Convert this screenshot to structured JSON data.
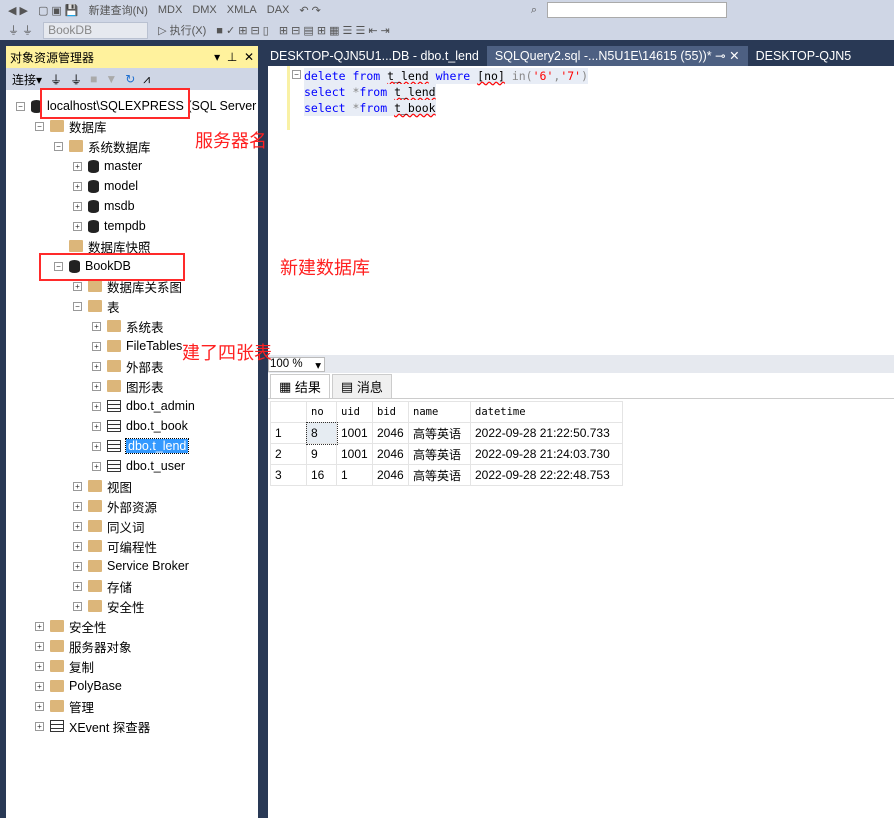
{
  "toolbar": {
    "new_query": "新建查询(N)",
    "database": "BookDB",
    "execute": "执行(X)",
    "mdx": "MDX",
    "dmx": "DMX",
    "xmla": "XMLA",
    "dax": "DAX"
  },
  "object_explorer": {
    "title": "对象资源管理器",
    "connect": "连接",
    "items": [
      {
        "label": "localhost\\SQLEXPRESS (SQL Server",
        "level": 0,
        "exp": "−",
        "icon": "server"
      },
      {
        "label": "数据库",
        "level": 1,
        "exp": "−",
        "icon": "folder"
      },
      {
        "label": "系统数据库",
        "level": 2,
        "exp": "−",
        "icon": "folder"
      },
      {
        "label": "master",
        "level": 3,
        "exp": "+",
        "icon": "db"
      },
      {
        "label": "model",
        "level": 3,
        "exp": "+",
        "icon": "db"
      },
      {
        "label": "msdb",
        "level": 3,
        "exp": "+",
        "icon": "db"
      },
      {
        "label": "tempdb",
        "level": 3,
        "exp": "+",
        "icon": "db"
      },
      {
        "label": "数据库快照",
        "level": 2,
        "exp": "",
        "icon": "folder"
      },
      {
        "label": "BookDB",
        "level": 2,
        "exp": "−",
        "icon": "db"
      },
      {
        "label": "数据库关系图",
        "level": 3,
        "exp": "+",
        "icon": "folder"
      },
      {
        "label": "表",
        "level": 3,
        "exp": "−",
        "icon": "folder"
      },
      {
        "label": "系统表",
        "level": 4,
        "exp": "+",
        "icon": "folder"
      },
      {
        "label": "FileTables",
        "level": 4,
        "exp": "+",
        "icon": "folder"
      },
      {
        "label": "外部表",
        "level": 4,
        "exp": "+",
        "icon": "folder"
      },
      {
        "label": "图形表",
        "level": 4,
        "exp": "+",
        "icon": "folder"
      },
      {
        "label": "dbo.t_admin",
        "level": 4,
        "exp": "+",
        "icon": "table"
      },
      {
        "label": "dbo.t_book",
        "level": 4,
        "exp": "+",
        "icon": "table"
      },
      {
        "label": "dbo.t_lend",
        "level": 4,
        "exp": "+",
        "icon": "table",
        "selected": true
      },
      {
        "label": "dbo.t_user",
        "level": 4,
        "exp": "+",
        "icon": "table"
      },
      {
        "label": "视图",
        "level": 3,
        "exp": "+",
        "icon": "folder"
      },
      {
        "label": "外部资源",
        "level": 3,
        "exp": "+",
        "icon": "folder"
      },
      {
        "label": "同义词",
        "level": 3,
        "exp": "+",
        "icon": "folder"
      },
      {
        "label": "可编程性",
        "level": 3,
        "exp": "+",
        "icon": "folder"
      },
      {
        "label": "Service Broker",
        "level": 3,
        "exp": "+",
        "icon": "folder"
      },
      {
        "label": "存储",
        "level": 3,
        "exp": "+",
        "icon": "folder"
      },
      {
        "label": "安全性",
        "level": 3,
        "exp": "+",
        "icon": "folder"
      },
      {
        "label": "安全性",
        "level": 1,
        "exp": "+",
        "icon": "folder"
      },
      {
        "label": "服务器对象",
        "level": 1,
        "exp": "+",
        "icon": "folder"
      },
      {
        "label": "复制",
        "level": 1,
        "exp": "+",
        "icon": "folder"
      },
      {
        "label": "PolyBase",
        "level": 1,
        "exp": "+",
        "icon": "folder"
      },
      {
        "label": "管理",
        "level": 1,
        "exp": "+",
        "icon": "folder"
      },
      {
        "label": "XEvent 探查器",
        "level": 1,
        "exp": "+",
        "icon": "xevent"
      }
    ]
  },
  "tabs": [
    {
      "label": "DESKTOP-QJN5U1...DB - dbo.t_lend"
    },
    {
      "label": "SQLQuery2.sql -...N5U1E\\14615 (55))*",
      "active": true
    },
    {
      "label": "DESKTOP-QJN5"
    }
  ],
  "editor": {
    "lines": [
      [
        {
          "t": "delete",
          "c": "kw"
        },
        {
          "t": " "
        },
        {
          "t": "from",
          "c": "kw"
        },
        {
          "t": " "
        },
        {
          "t": "t_lend",
          "c": "sq"
        },
        {
          "t": " "
        },
        {
          "t": "where",
          "c": "kw"
        },
        {
          "t": " "
        },
        {
          "t": "[no]",
          "c": "sq"
        },
        {
          "t": " "
        },
        {
          "t": "in(",
          "c": "gr"
        },
        {
          "t": "'6'",
          "c": "str"
        },
        {
          "t": ",",
          "c": "gr"
        },
        {
          "t": "'7'",
          "c": "str"
        },
        {
          "t": ")",
          "c": "gr"
        }
      ],
      [
        {
          "t": "select",
          "c": "kw"
        },
        {
          "t": " "
        },
        {
          "t": "*",
          "c": "gr"
        },
        {
          "t": "from",
          "c": "kw"
        },
        {
          "t": " "
        },
        {
          "t": "t_lend",
          "c": "sq"
        }
      ],
      [
        {
          "t": "select",
          "c": "kw"
        },
        {
          "t": " "
        },
        {
          "t": "*",
          "c": "gr"
        },
        {
          "t": "from",
          "c": "kw"
        },
        {
          "t": " "
        },
        {
          "t": "t_book",
          "c": "sq"
        }
      ]
    ]
  },
  "zoom": "100 %",
  "result_tabs": {
    "results": "结果",
    "messages": "消息"
  },
  "results": {
    "columns": [
      "",
      "no",
      "uid",
      "bid",
      "name",
      "datetime"
    ],
    "rows": [
      [
        "1",
        "8",
        "1001",
        "2046",
        "高等英语",
        "2022-09-28 21:22:50.733"
      ],
      [
        "2",
        "9",
        "1001",
        "2046",
        "高等英语",
        "2022-09-28 21:24:03.730"
      ],
      [
        "3",
        "16",
        "1",
        "2046",
        "高等英语",
        "2022-09-28 22:22:48.753"
      ]
    ]
  },
  "annotations": {
    "server": "服务器名",
    "newdb": "新建数据库",
    "tables": "建了四张表"
  },
  "colors": {
    "annotation": "#ff2a2a",
    "panel_title": "#fff29d",
    "chrome": "#293955"
  }
}
